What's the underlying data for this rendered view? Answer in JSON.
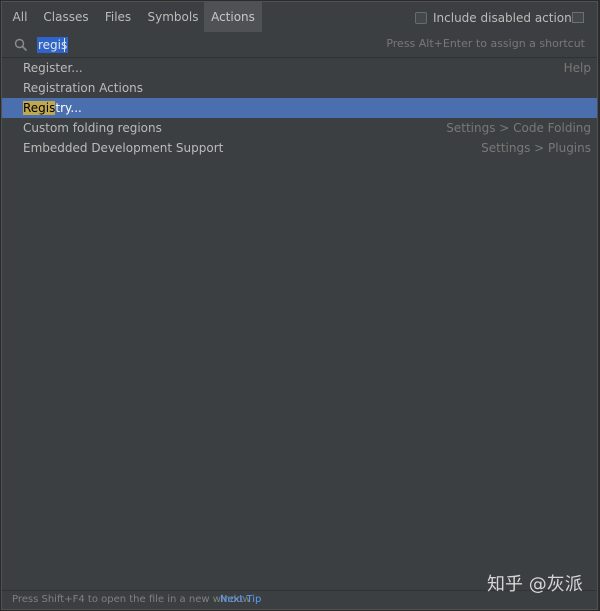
{
  "tabs": [
    {
      "label": "All"
    },
    {
      "label": "Classes"
    },
    {
      "label": "Files"
    },
    {
      "label": "Symbols"
    },
    {
      "label": "Actions"
    }
  ],
  "include_disabled": {
    "label": "Include disabled actions",
    "checked": false
  },
  "search": {
    "value": "regis",
    "hint": "Press Alt+Enter to assign a shortcut"
  },
  "results": [
    {
      "label": "Register...",
      "hint": "Help"
    },
    {
      "label": "Registration Actions",
      "hint": ""
    },
    {
      "label_match": "Regis",
      "label_rest": "try...",
      "hint": ""
    },
    {
      "label": "Custom folding regions",
      "hint": "Settings > Code Folding"
    },
    {
      "label": "Embedded Development Support",
      "hint": "Settings > Plugins"
    }
  ],
  "footer": {
    "tip": "Press Shift+F4 to open the file in a new window",
    "next_tip": "Next Tip"
  },
  "watermark": "知乎 @灰派",
  "colors": {
    "background": "#3c3f41",
    "selection": "#4b6eaf",
    "match_highlight": "#c1a84f",
    "link": "#589df6"
  }
}
